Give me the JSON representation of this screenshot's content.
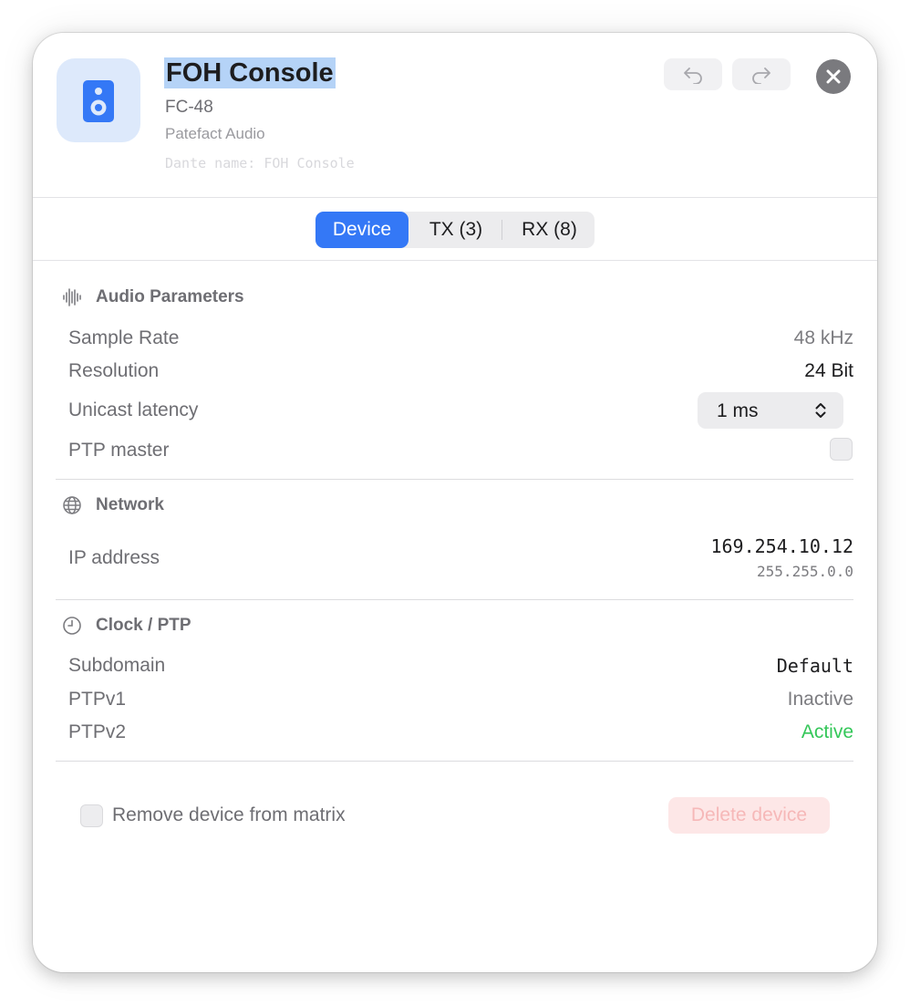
{
  "header": {
    "title": "FOH Console",
    "model": "FC-48",
    "vendor": "Patefact Audio",
    "dante_name": "Dante name: FOH Console",
    "icon": "speaker-icon"
  },
  "toolbar": {
    "undo_icon": "undo-icon",
    "redo_icon": "redo-icon",
    "close_icon": "close-icon"
  },
  "tabs": [
    {
      "label": "Device",
      "active": true
    },
    {
      "label": "TX (3)",
      "active": false
    },
    {
      "label": "RX (8)",
      "active": false
    }
  ],
  "audio": {
    "heading": "Audio Parameters",
    "icon": "waveform-icon",
    "sample_rate_label": "Sample Rate",
    "sample_rate_value": "48 kHz",
    "resolution_label": "Resolution",
    "resolution_value": "24 Bit",
    "latency_label": "Unicast latency",
    "latency_value": "1 ms",
    "ptp_master_label": "PTP master",
    "ptp_master_checked": false
  },
  "network": {
    "heading": "Network",
    "icon": "globe-icon",
    "ip_label": "IP address",
    "ip_value": "169.254.10.12",
    "subnet_value": "255.255.0.0"
  },
  "clock": {
    "heading": "Clock / PTP",
    "icon": "clock-icon",
    "subdomain_label": "Subdomain",
    "subdomain_value": "Default",
    "ptpv1_label": "PTPv1",
    "ptpv1_value": "Inactive",
    "ptpv2_label": "PTPv2",
    "ptpv2_value": "Active"
  },
  "footer": {
    "remove_label": "Remove device from matrix",
    "remove_checked": false,
    "delete_label": "Delete device"
  },
  "colors": {
    "accent": "#3478f6",
    "active_green": "#34c759",
    "delete_bg": "#fde7e7",
    "delete_text": "#f6b8b8"
  }
}
